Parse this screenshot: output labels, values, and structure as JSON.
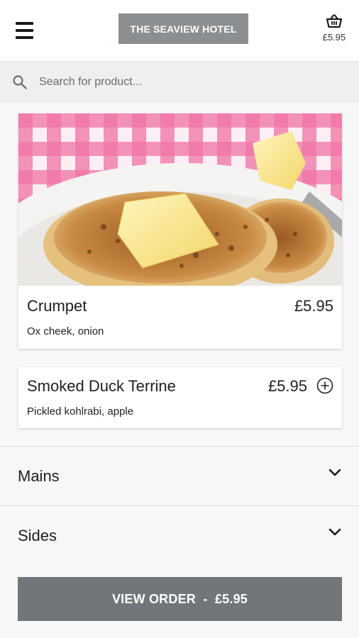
{
  "header": {
    "logo_text": "THE SEAVIEW HOTEL",
    "basket_total": "£5.95"
  },
  "search": {
    "placeholder": "Search for product..."
  },
  "items": [
    {
      "name": "Crumpet",
      "price": "£5.95",
      "description": "Ox cheek, onion",
      "image": "crumpet-with-butter-photo"
    },
    {
      "name": "Smoked Duck Terrine",
      "price": "£5.95",
      "description": "Pickled kohlrabi, apple",
      "action_icon": "add-circle-icon"
    }
  ],
  "sections": [
    {
      "title": "Mains",
      "icon": "chevron-down-icon"
    },
    {
      "title": "Sides",
      "icon": "chevron-down-icon"
    }
  ],
  "order_button": {
    "label": "VIEW ORDER  -  £5.95"
  },
  "colors": {
    "logo_bg": "#8c8f91",
    "button_bg": "#70767a",
    "page_bg": "#f7f7f7",
    "search_bg": "#efefef"
  }
}
